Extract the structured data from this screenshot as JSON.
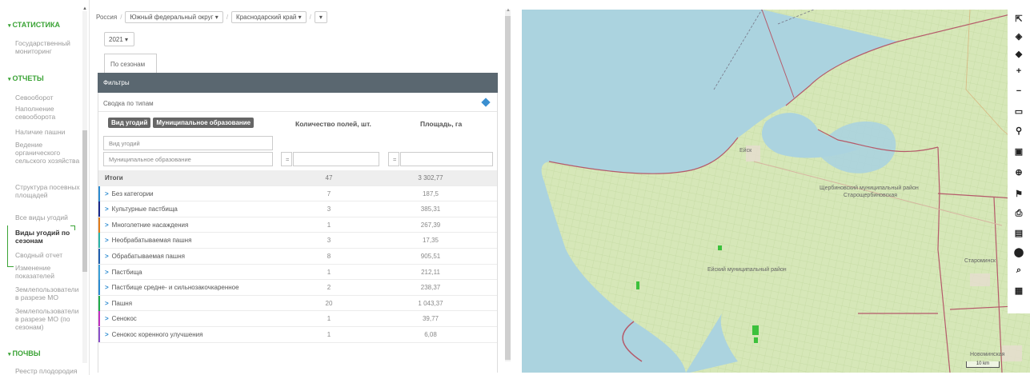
{
  "sidebar": {
    "sections": [
      {
        "label": "СТАТИСТИКА"
      },
      {
        "label": "ОТЧЕТЫ"
      },
      {
        "label": "ПОЧВЫ"
      }
    ],
    "items": [
      {
        "label": "Государственный мониторинг"
      },
      {
        "label": "Севооборот"
      },
      {
        "label": "Наполнение севооборота"
      },
      {
        "label": "Наличие пашни"
      },
      {
        "label": "Ведение органического сельского хозяйства"
      },
      {
        "label": "Структура посевных площадей"
      },
      {
        "label": "Все виды угодий"
      },
      {
        "label": "Виды угодий по сезонам"
      },
      {
        "label": "Сводный отчет"
      },
      {
        "label": "Изменение показателей"
      },
      {
        "label": "Землепользователи в разрезе МО"
      },
      {
        "label": "Землепользователи в разрезе МО (по сезонам)"
      },
      {
        "label": "Реестр плодородия"
      }
    ]
  },
  "breadcrumb": {
    "country": "Россия",
    "district": "Южный федеральный округ",
    "region": "Краснодарский край",
    "separator": "/",
    "caret": "▾"
  },
  "year": "2021",
  "tab": "По сезонам",
  "filters_label": "Фильтры",
  "summary_label": "Сводка по типам",
  "chips": [
    "Вид угодий",
    "Муниципальное образование"
  ],
  "columns": {
    "count": "Количество полей, шт.",
    "area": "Площадь, га"
  },
  "filter_inputs": {
    "type_placeholder": "Вид угодий",
    "mo_placeholder": "Муниципальное образование",
    "eq1": "=",
    "eq2": "="
  },
  "table": {
    "total": {
      "label": "Итоги",
      "count": "47",
      "area": "3 302,77"
    },
    "rows": [
      {
        "label": "Без категории",
        "count": "7",
        "area": "187,5",
        "color": "#2b8ad0"
      },
      {
        "label": "Культурные пастбища",
        "count": "3",
        "area": "385,31",
        "color": "#1a2a8a"
      },
      {
        "label": "Многолетние насаждения",
        "count": "1",
        "area": "267,39",
        "color": "#e07b1a"
      },
      {
        "label": "Необрабатываемая пашня",
        "count": "3",
        "area": "17,35",
        "color": "#2bb3a8"
      },
      {
        "label": "Обрабатываемая пашня",
        "count": "8",
        "area": "905,51",
        "color": "#1f5fb0"
      },
      {
        "label": "Пастбища",
        "count": "1",
        "area": "212,11",
        "color": "#3a9fd8"
      },
      {
        "label": "Пастбище средне- и сильнозакочкаренное",
        "count": "2",
        "area": "238,37",
        "color": "#2a8ad0"
      },
      {
        "label": "Пашня",
        "count": "20",
        "area": "1 043,37",
        "color": "#1faa4a"
      },
      {
        "label": "Сенокос",
        "count": "1",
        "area": "39,77",
        "color": "#c030c0"
      },
      {
        "label": "Сенокос коренного улучшения",
        "count": "1",
        "area": "6,08",
        "color": "#8a50c8"
      }
    ]
  },
  "map": {
    "labels": {
      "yeysk_mo": "Ейский муниципальный район",
      "shcherb": "Щербиновский муниципальный район",
      "starosherb": "Старощербиновская",
      "starominsk": "Староминск",
      "novominsk": "Новоминская",
      "yeysk": "Ейск"
    },
    "scale": "10 km"
  },
  "toolbar": [
    {
      "name": "select-tool-icon",
      "glyph": "⇱"
    },
    {
      "name": "layers-icon",
      "glyph": "◈"
    },
    {
      "name": "layers-alt-icon",
      "glyph": "◆"
    },
    {
      "name": "zoom-in-icon",
      "glyph": "+"
    },
    {
      "name": "zoom-out-icon",
      "glyph": "−"
    },
    {
      "name": "ruler-icon",
      "glyph": "▭"
    },
    {
      "name": "pin-icon",
      "glyph": "⚲"
    },
    {
      "name": "rectangle-icon",
      "glyph": "▣"
    },
    {
      "name": "zoom-area-icon",
      "glyph": "⊕"
    },
    {
      "name": "flag-icon",
      "glyph": "⚑"
    },
    {
      "name": "print-icon",
      "glyph": "⎙"
    },
    {
      "name": "layout-icon",
      "glyph": "▤"
    },
    {
      "name": "location-icon",
      "glyph": "⬤"
    },
    {
      "name": "search-icon",
      "glyph": "⌕"
    },
    {
      "name": "report-icon",
      "glyph": "▦"
    }
  ]
}
